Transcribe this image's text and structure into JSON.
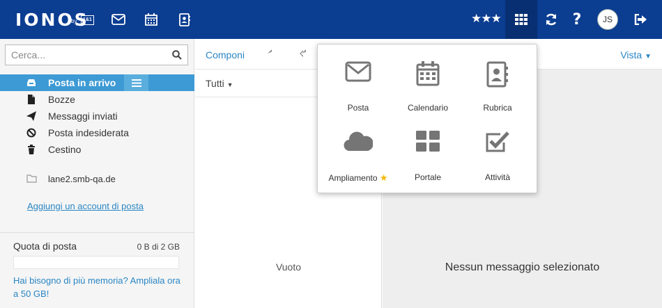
{
  "header": {
    "logo": "IONOS",
    "logo_by": "by",
    "logo_brand": "1&1",
    "avatar_initials": "JS",
    "icons": [
      "mail-icon",
      "calendar-icon",
      "contacts-icon",
      "stars-icon",
      "apps-grid-icon",
      "refresh-icon",
      "help-icon",
      "logout-icon"
    ]
  },
  "sidebar": {
    "search_placeholder": "Cerca...",
    "folders": [
      {
        "label": "Posta in arrivo",
        "icon": "inbox-icon",
        "active": true
      },
      {
        "label": "Bozze",
        "icon": "draft-icon"
      },
      {
        "label": "Messaggi inviati",
        "icon": "sent-icon"
      },
      {
        "label": "Posta indesiderata",
        "icon": "spam-icon"
      },
      {
        "label": "Cestino",
        "icon": "trash-icon"
      }
    ],
    "account": "lane2.smb-qa.de",
    "add_account": "Aggiungi un account di posta",
    "quota": {
      "title": "Quota di posta",
      "value": "0 B di 2 GB",
      "used_fraction": 0,
      "upgrade": "Hai bisogno di più memoria? Ampliala ora a 50 GB!"
    }
  },
  "toolbar": {
    "compose": "Componi",
    "view": "Vista"
  },
  "list": {
    "filter": "Tutti",
    "empty": "Vuoto"
  },
  "reader": {
    "empty": "Nessun messaggio selezionato"
  },
  "apps": [
    {
      "label": "Posta",
      "icon": "mail-icon"
    },
    {
      "label": "Calendario",
      "icon": "calendar-icon"
    },
    {
      "label": "Rubrica",
      "icon": "contacts-icon"
    },
    {
      "label": "Ampliamento",
      "icon": "cloud-icon",
      "badge": "star-icon"
    },
    {
      "label": "Portale",
      "icon": "portal-grid-icon"
    },
    {
      "label": "Attività",
      "icon": "tasks-icon"
    }
  ],
  "colors": {
    "header": "#0b3d91",
    "accent": "#3d9ad4",
    "link": "#2a86c4",
    "star": "#f5b800"
  }
}
